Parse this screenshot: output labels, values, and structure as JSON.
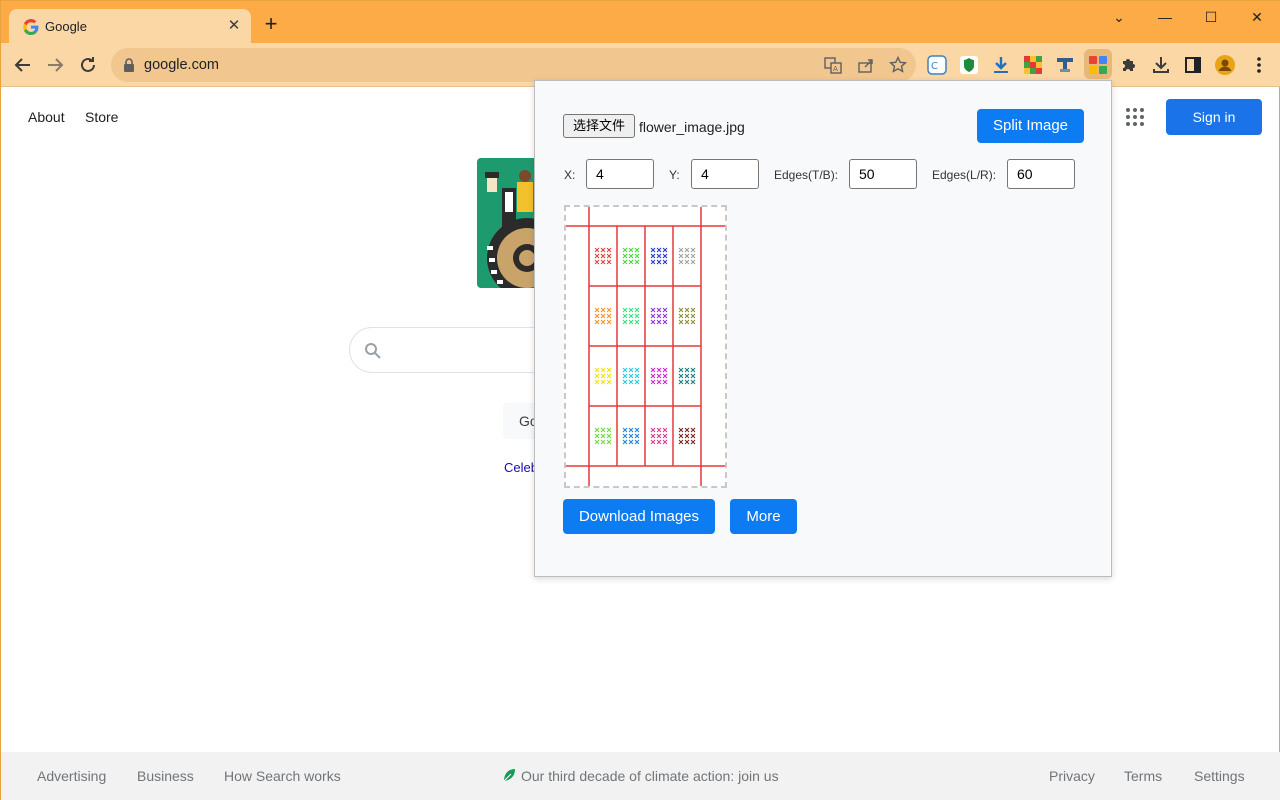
{
  "browser": {
    "tab_title": "Google",
    "new_tab_symbol": "+",
    "close_tab_symbol": "✕",
    "url": "google.com",
    "window_controls": [
      "⌄",
      "—",
      "☐",
      "✕"
    ]
  },
  "google": {
    "top_left_links": [
      "About",
      "Store"
    ],
    "sign_in": "Sign in",
    "search_button_partial": "Go",
    "celebrate_partial": "Celeb"
  },
  "footer": {
    "left_links": [
      "Advertising",
      "Business",
      "How Search works"
    ],
    "climate": "Our third decade of climate action: join us",
    "right_links": [
      "Privacy",
      "Terms",
      "Settings"
    ]
  },
  "popup": {
    "choose_file": "选择文件",
    "file_name": "flower_image.jpg",
    "split_button": "Split Image",
    "fields": {
      "x_label": "X:",
      "x_value": "4",
      "y_label": "Y:",
      "y_value": "4",
      "edges_tb_label": "Edges(T/B):",
      "edges_tb_value": "50",
      "edges_lr_label": "Edges(L/R):",
      "edges_lr_value": "60"
    },
    "download_button": "Download Images",
    "more_button": "More",
    "preview": {
      "grid_columns": 4,
      "grid_rows": 4,
      "cell_colors": [
        [
          "#e53935",
          "#43d635",
          "#1e2ed8",
          "#9e9e9e"
        ],
        [
          "#ff8c1a",
          "#2ee07a",
          "#8a2be2",
          "#8a8a2e"
        ],
        [
          "#f5e000",
          "#1ec8e0",
          "#d11cd1",
          "#0f7a7a"
        ],
        [
          "#66d933",
          "#1a7ee0",
          "#e0338a",
          "#7a1a1a"
        ]
      ]
    }
  },
  "colors": {
    "tabbar": "#fdab47",
    "toolbar": "#fbd7a6",
    "accent_blue": "#1a73e8",
    "popup_button_blue": "#0d7cf2",
    "grid_line_red": "#e53935"
  }
}
